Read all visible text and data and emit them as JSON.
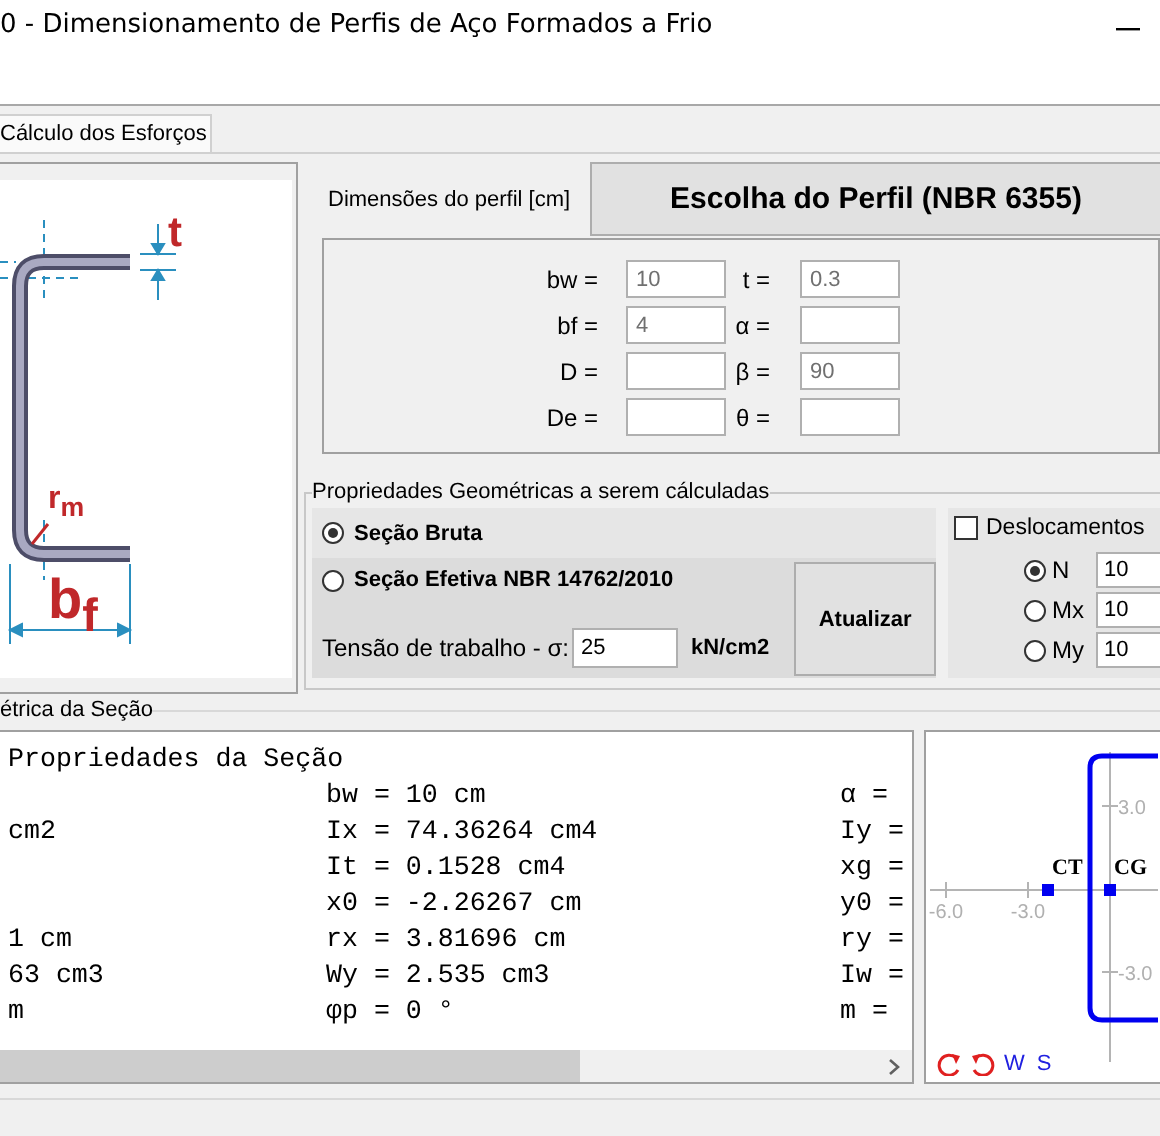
{
  "window": {
    "title": "0 - Dimensionamento de Perfis de Aço Formados a Frio"
  },
  "tabs": [
    {
      "label": "Cálculo dos Esforços",
      "selected": true
    }
  ],
  "figure_labels": {
    "t": "t",
    "rm": "r$_{m}$",
    "bf": "b$_{f}$"
  },
  "dimensions": {
    "label": "Dimensões do perfil [cm]",
    "choose_button": "Escolha do Perfil (NBR 6355)",
    "fields": [
      {
        "label": "bw =",
        "value": "10",
        "disabled": true
      },
      {
        "label": "t =",
        "value": "0.3",
        "disabled": true
      },
      {
        "label": "bf =",
        "value": "4",
        "disabled": true
      },
      {
        "label": "α =",
        "disabled": true
      },
      {
        "label": "D =",
        "disabled": true
      },
      {
        "label": "β =",
        "value": "90",
        "disabled": true
      },
      {
        "label": "De =",
        "disabled": true
      },
      {
        "label": "θ =",
        "disabled": true
      }
    ]
  },
  "properties": {
    "title": "Propriedades Geométricas a serem cálculadas",
    "section_options": [
      {
        "label": "Seção Bruta",
        "selected": true
      },
      {
        "label": "Seção Efetiva NBR 14762/2010",
        "selected": false
      }
    ],
    "stress": {
      "label": "Tensão de trabalho - σ:",
      "value": "25",
      "unit": "kN/cm2"
    },
    "update_button": "Atualizar",
    "displacements": {
      "label": "Deslocamentos",
      "checked": false,
      "options": [
        {
          "label": "N",
          "selected": true,
          "value": "10"
        },
        {
          "label": "Mx",
          "selected": false,
          "value": "10"
        },
        {
          "label": "My",
          "selected": false,
          "value": "10"
        }
      ]
    }
  },
  "section_results": {
    "title": "étrica da Seção",
    "heading": "Propriedades da Seção",
    "rows": [
      [
        "",
        "bw = 10 cm",
        "α ="
      ],
      [
        "cm2",
        "Ix = 74.36264 cm4",
        "Iy ="
      ],
      [
        "",
        "It = 0.1528 cm4",
        "xg ="
      ],
      [
        "",
        "x0 = -2.26267 cm",
        "y0 ="
      ],
      [
        "1 cm",
        "rx = 3.81696 cm",
        "ry ="
      ],
      [
        "63 cm3",
        "Wy = 2.535 cm3",
        "Iw ="
      ],
      [
        "m",
        "φp = 0 °",
        "m ="
      ]
    ]
  },
  "plot": {
    "x_ticks": [
      "-6.0",
      "-3.0"
    ],
    "y_ticks": [
      "3.0",
      "-3.0"
    ],
    "points": [
      {
        "label": "CT"
      },
      {
        "label": "CG"
      }
    ],
    "tools": [
      "W",
      "S"
    ]
  }
}
